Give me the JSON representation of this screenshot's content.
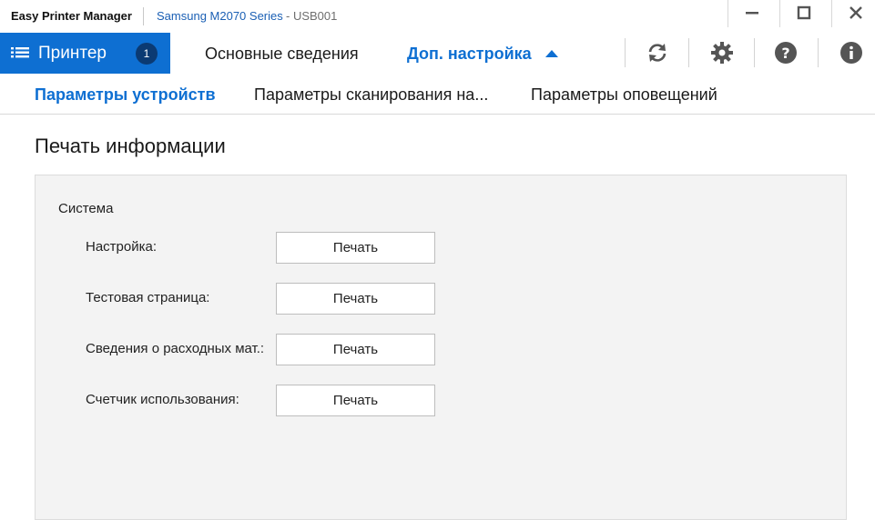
{
  "titlebar": {
    "app_name": "Easy Printer Manager",
    "device_name": "Samsung M2070 Series",
    "device_port": " - USB001"
  },
  "window_controls": {
    "minimize": "—",
    "maximize": "☐",
    "close": "✕"
  },
  "nav": {
    "printer_label": "Принтер",
    "printer_count": "1",
    "basic_info": "Основные сведения",
    "advanced": "Доп. настройка",
    "icons": [
      "refresh-icon",
      "gear-icon",
      "help-icon",
      "info-icon"
    ]
  },
  "subtabs": [
    {
      "label": "Параметры устройств",
      "active": true
    },
    {
      "label": "Параметры сканирования на...",
      "active": false
    },
    {
      "label": "Параметры оповещений",
      "active": false
    }
  ],
  "section": {
    "title": "Печать информации",
    "group": "Система",
    "rows": [
      {
        "label": "Настройка:",
        "button": "Печать"
      },
      {
        "label": "Тестовая страница:",
        "button": "Печать"
      },
      {
        "label": "Сведения о расходных мат.:",
        "button": "Печать"
      },
      {
        "label": "Счетчик использования:",
        "button": "Печать"
      }
    ]
  },
  "colors": {
    "accent": "#0e6fd2",
    "badge": "#0b3a73",
    "panel": "#f3f3f3"
  }
}
